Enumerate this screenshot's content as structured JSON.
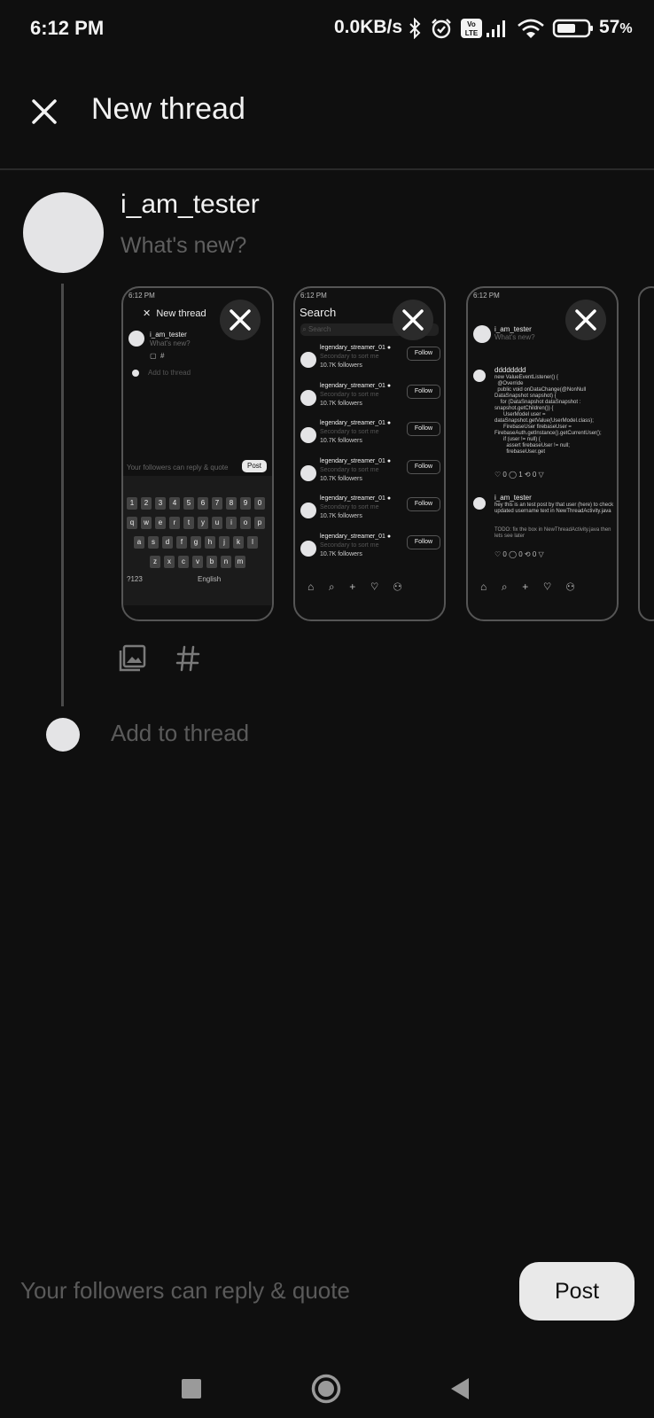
{
  "status_bar": {
    "time": "6:12 PM",
    "network_speed": "0.0KB/s",
    "battery_percent": "57",
    "battery_unit": "%",
    "icons": [
      "bluetooth-icon",
      "alarm-icon",
      "volte-icon",
      "signal-icon",
      "wifi-icon",
      "battery-icon"
    ]
  },
  "header": {
    "title": "New thread",
    "close_icon": "close-icon"
  },
  "composer": {
    "username": "i_am_tester",
    "placeholder": "What's new?",
    "tools": [
      "gallery-icon",
      "hashtag-icon"
    ]
  },
  "attachments": {
    "shot1": {
      "time": "6:12 PM",
      "title": "New thread",
      "username": "i_am_tester",
      "placeholder": "What's new?",
      "add": "Add to thread",
      "footer": "Your followers can reply & quote",
      "post": "Post",
      "keyboard_lang": "English",
      "num_row": [
        "1",
        "2",
        "3",
        "4",
        "5",
        "6",
        "7",
        "8",
        "9",
        "0"
      ],
      "row1": [
        "q",
        "w",
        "e",
        "r",
        "t",
        "y",
        "u",
        "i",
        "o",
        "p"
      ],
      "row2": [
        "a",
        "s",
        "d",
        "f",
        "g",
        "h",
        "j",
        "k",
        "l"
      ],
      "row3": [
        "z",
        "x",
        "c",
        "v",
        "b",
        "n",
        "m"
      ],
      "sym": "?123"
    },
    "shot2": {
      "time": "6:12 PM",
      "title": "Search",
      "search_placeholder": "Search",
      "rows": [
        {
          "name": "legendary_streamer_01",
          "sub": "Secondary to sort me",
          "followers": "10.7K followers",
          "button": "Follow"
        },
        {
          "name": "legendary_streamer_01",
          "sub": "Secondary to sort me",
          "followers": "10.7K followers",
          "button": "Follow"
        },
        {
          "name": "legendary_streamer_01",
          "sub": "Secondary to sort me",
          "followers": "10.7K followers",
          "button": "Follow"
        },
        {
          "name": "legendary_streamer_01",
          "sub": "Secondary to sort me",
          "followers": "10.7K followers",
          "button": "Follow"
        },
        {
          "name": "legendary_streamer_01",
          "sub": "Secondary to sort me",
          "followers": "10.7K followers",
          "button": "Follow"
        },
        {
          "name": "legendary_streamer_01",
          "sub": "Secondary to sort me",
          "followers": "10.7K followers",
          "button": "Follow"
        }
      ]
    },
    "shot3": {
      "time": "6:12 PM",
      "username": "i_am_tester",
      "placeholder": "What's new?",
      "post1_user": "dddddddd",
      "post1_text": "new ValueEventListener() {\n  @Override\n  public void onDataChange(@NonNull DataSnapshot snapshot) {\n    for (DataSnapshot dataSnapshot : snapshot.getChildren()) {\n      UserModel user = dataSnapshot.getValue(UserModel.class);\n      FirebaseUser firebaseUser = FirebaseAuth.getInstance().getCurrentUser();\n      if (user != null) {\n        assert firebaseUser != null;\n        firebaseUser.get",
      "post1_stats": "♡ 0  ◯ 1  ⟲ 0  ▽",
      "post2_user": "i_am_tester",
      "post2_text": "hey this is an test post by that user (here) to check updated username text in NewThreadActivity.java",
      "post2_sub": "TODO: fix the box in NewThreadActivity.java then lets see later",
      "post2_stats": "♡ 0  ◯ 0  ⟲ 0  ▽"
    }
  },
  "thread": {
    "add_to_thread": "Add to thread"
  },
  "footer": {
    "reply_setting": "Your followers can reply & quote",
    "post_button": "Post"
  },
  "nav": {
    "buttons": [
      "recents-icon",
      "home-icon",
      "back-icon"
    ]
  }
}
